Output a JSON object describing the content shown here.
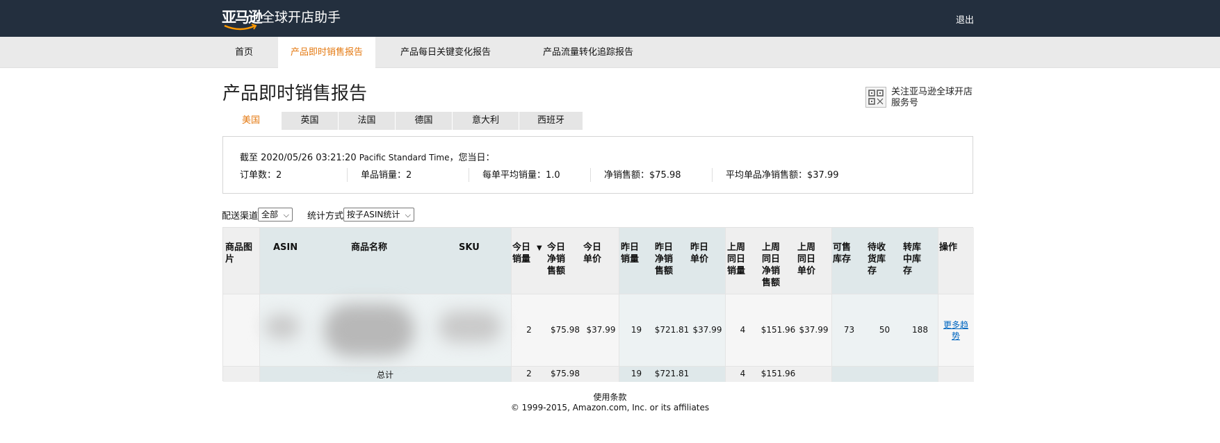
{
  "header": {
    "brand": "亚马逊",
    "subtitle": "全球开店助手",
    "logout": "退出"
  },
  "nav": {
    "items": [
      {
        "label": "首页"
      },
      {
        "label": "产品即时销售报告"
      },
      {
        "label": "产品每日关键变化报告"
      },
      {
        "label": "产品流量转化追踪报告"
      }
    ],
    "active_index": 1
  },
  "page": {
    "title": "产品即时销售报告",
    "follow_text": "关注亚马逊全球开店服务号"
  },
  "country_tabs": [
    {
      "label": "美国"
    },
    {
      "label": "英国"
    },
    {
      "label": "法国"
    },
    {
      "label": "德国"
    },
    {
      "label": "意大利"
    },
    {
      "label": "西班牙"
    }
  ],
  "summary": {
    "asof_prefix": "截至",
    "asof_time": "2020/05/26 03:21:20",
    "asof_tz": "Pacific Standard Time",
    "asof_suffix": "，您当日：",
    "stats": [
      {
        "label": "订单数：",
        "value": "2"
      },
      {
        "label": "单品销量：",
        "value": "2"
      },
      {
        "label": "每单平均销量：",
        "value": "1.0"
      },
      {
        "label": "净销售额：",
        "value": "$75.98"
      },
      {
        "label": "平均单品净销售额：",
        "value": "$37.99"
      }
    ]
  },
  "filters": {
    "channel_label": "配送渠道",
    "channel_value": "全部",
    "method_label": "统计方式",
    "method_value": "按子ASIN统计"
  },
  "table": {
    "headers": {
      "image": "商品图片",
      "asin": "ASIN",
      "name": "商品名称",
      "sku": "SKU",
      "today_qty": "今日销量",
      "today_net": "今日净销售额",
      "today_price": "今日单价",
      "yday_qty": "昨日销量",
      "yday_net": "昨日净销售额",
      "yday_price": "昨日单价",
      "lw_qty": "上周同日销量",
      "lw_net": "上周同日净销售额",
      "lw_price": "上周同日单价",
      "sellable": "可售库存",
      "inbound": "待收货库存",
      "transfer": "转库中库存",
      "action": "操作"
    },
    "row": {
      "today_qty": "2",
      "today_net": "$75.98",
      "today_price": "$37.99",
      "yday_qty": "19",
      "yday_net": "$721.81",
      "yday_price": "$37.99",
      "lw_qty": "4",
      "lw_net": "$151.96",
      "lw_price": "$37.99",
      "sellable": "73",
      "inbound": "50",
      "transfer": "188",
      "action": "更多趋势"
    },
    "total": {
      "label": "总计",
      "today_qty": "2",
      "today_net": "$75.98",
      "yday_qty": "19",
      "yday_net": "$721.81",
      "lw_qty": "4",
      "lw_net": "$151.96"
    }
  },
  "footer": {
    "terms": "使用条款",
    "copyright": "© 1999-2015, Amazon.com, Inc. or its affiliates"
  },
  "colors": {
    "header_bg": "#232f3e",
    "accent": "#e47911",
    "link": "#0066c0",
    "column_blue": "#dfe8ea",
    "column_grey": "#efefef"
  }
}
